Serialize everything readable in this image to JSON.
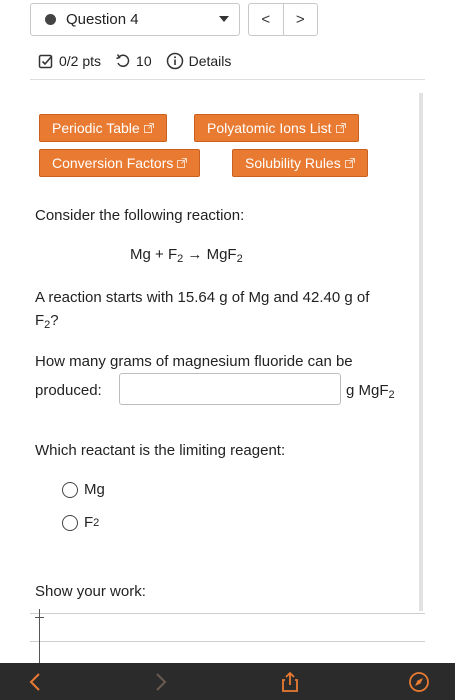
{
  "header": {
    "question_label": "Question 4",
    "prev_label": "<",
    "next_label": ">"
  },
  "meta": {
    "points": "0/2 pts",
    "attempts": "10",
    "details": "Details"
  },
  "resources": {
    "periodic_table": "Periodic Table",
    "polyatomic_ions": "Polyatomic Ions List",
    "conversion_factors": "Conversion Factors",
    "solubility_rules": "Solubility Rules"
  },
  "question": {
    "intro": "Consider the following reaction:",
    "reaction": {
      "reactant1": "Mg",
      "plus": " + ",
      "reactant2_base": "F",
      "reactant2_sub": "2",
      "arrow": " → ",
      "product_base": "MgF",
      "product_sub": "2"
    },
    "statement_line1": "A reaction starts with 15.64 g of Mg and 42.40 g of",
    "statement_line2_base": "F",
    "statement_line2_sub": "2",
    "statement_line2_end": "?",
    "grams_prompt_line1": "How many grams of magnesium fluoride can be",
    "grams_prompt_line2": "produced:",
    "answer_value": "",
    "unit_base": "g MgF",
    "unit_sub": "2",
    "limiting_prompt": "Which reactant is the limiting reagent:",
    "options": [
      {
        "base": "Mg",
        "sub": ""
      },
      {
        "base": "F",
        "sub": "2"
      }
    ],
    "work_prompt": "Show your work:"
  },
  "colors": {
    "accent": "#e97a31",
    "toolbar": "#2b2b2b",
    "toolbar_icon": "#e97a31"
  },
  "icons": [
    "chevron-left-icon",
    "chevron-right-icon",
    "share-icon",
    "compass-icon"
  ]
}
